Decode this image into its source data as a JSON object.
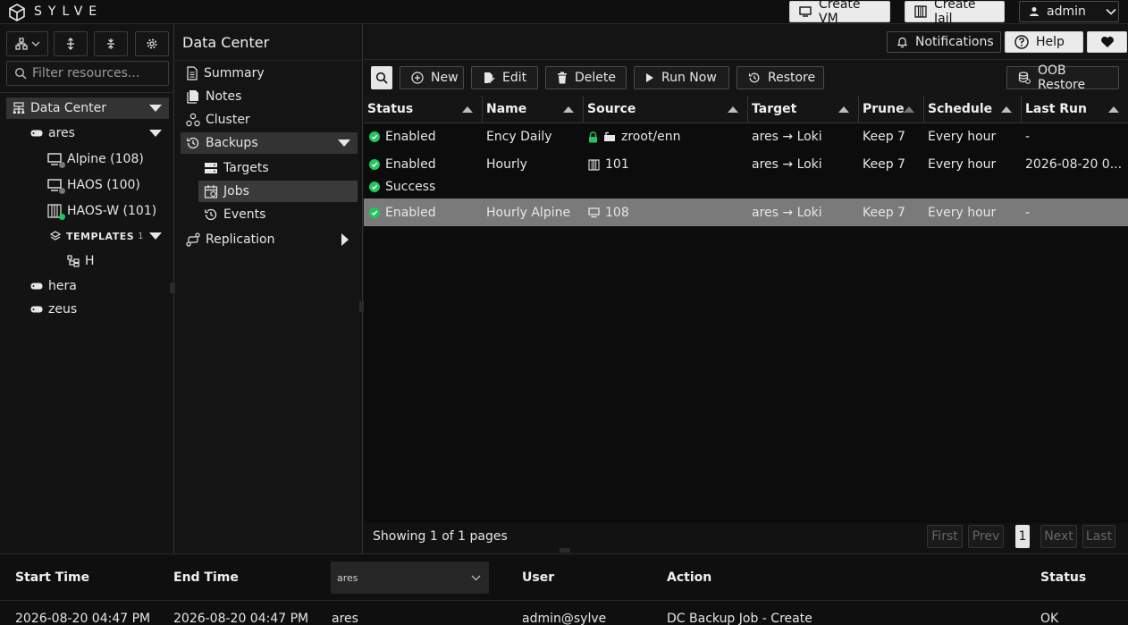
{
  "topbar": {
    "brand": "SYLVE",
    "create_vm": "Create VM",
    "create_jail": "Create Jail",
    "user": "admin"
  },
  "left": {
    "filter_placeholder": "Filter resources...",
    "tree": {
      "datacenter": "Data Center",
      "ares": "ares",
      "alpine": "Alpine (108)",
      "haos": "HAOS (100)",
      "haosw": "HAOS-W (101)",
      "templates": "TEMPLATES",
      "templates_count": "1",
      "h": "H",
      "hera": "hera",
      "zeus": "zeus"
    }
  },
  "mid": {
    "title": "Data Center",
    "nav": {
      "summary": "Summary",
      "notes": "Notes",
      "cluster": "Cluster",
      "backups": "Backups",
      "targets": "Targets",
      "jobs": "Jobs",
      "events": "Events",
      "replication": "Replication"
    }
  },
  "header": {
    "notifications": "Notifications",
    "help": "Help"
  },
  "toolbar": {
    "new": "New",
    "edit": "Edit",
    "delete": "Delete",
    "run_now": "Run Now",
    "restore": "Restore",
    "oob_restore": "OOB Restore"
  },
  "table": {
    "columns": [
      "Status",
      "Name",
      "Source",
      "Target",
      "Prune",
      "Schedule",
      "Last Run"
    ],
    "rows": [
      {
        "status": "Enabled",
        "status2": "",
        "name": "Ency Daily",
        "source": "zroot/enn",
        "target": "ares → Loki",
        "prune": "Keep 7",
        "schedule": "Every hour",
        "last_run": "-"
      },
      {
        "status": "Enabled",
        "status2": "Success",
        "name": "Hourly",
        "source": "101",
        "target": "ares → Loki",
        "prune": "Keep 7",
        "schedule": "Every hour",
        "last_run": "2026-08-20 0..."
      },
      {
        "status": "Enabled",
        "status2": "",
        "name": "Hourly Alpine",
        "source": "108",
        "target": "ares → Loki",
        "prune": "Keep 7",
        "schedule": "Every hour",
        "last_run": "-"
      }
    ]
  },
  "pager": {
    "info": "Showing 1 of 1 pages",
    "first": "First",
    "prev": "Prev",
    "page": "1",
    "next": "Next",
    "last": "Last"
  },
  "bottom": {
    "columns": {
      "start": "Start Time",
      "end": "End Time",
      "user": "User",
      "action": "Action",
      "status": "Status"
    },
    "filter_value": "ares",
    "row": {
      "start": "2026-08-20 04:47 PM",
      "end": "2026-08-20 04:47 PM",
      "node": "ares",
      "user": "admin@sylve",
      "action": "DC Backup Job - Create",
      "status": "OK"
    }
  },
  "colors": {
    "accent_green": "#22c55e",
    "selected_row": "#7a7a7a"
  }
}
